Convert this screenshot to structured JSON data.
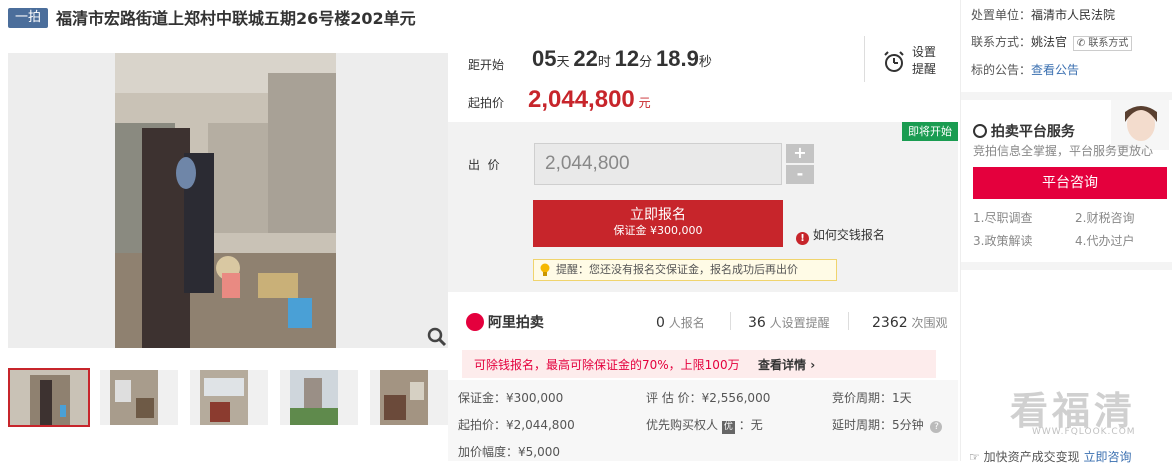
{
  "header": {
    "tag": "一拍",
    "title": "福清市宏路街道上郑村中联城五期26号楼202单元"
  },
  "countdown": {
    "label": "距开始",
    "days": "05",
    "days_unit": "天",
    "hours": "22",
    "hours_unit": "时",
    "minutes": "12",
    "minutes_unit": "分",
    "seconds": "18.9",
    "seconds_unit": "秒"
  },
  "reminder": {
    "line1": "设置",
    "line2": "提醒"
  },
  "start_price": {
    "label": "起拍价",
    "value": "2,044,800",
    "unit": "元"
  },
  "bid": {
    "badge": "即将开始",
    "label": "出  价",
    "input_value": "2,044,800",
    "plus": "+",
    "minus": "-",
    "signup_label": "立即报名",
    "deposit_label": "保证金 ¥300,000",
    "how_to_label": "如何交钱报名",
    "tip": "提醒：您还没有报名交保证金，报名成功后再出价"
  },
  "stats": {
    "brand": "阿里拍卖",
    "signups": "0",
    "signups_label": "人报名",
    "reminders": "36",
    "reminders_label": "人设置提醒",
    "views": "2362",
    "views_label": "次围观"
  },
  "warning": {
    "text": "可除钱报名，最高可除保证金的70%，上限100万",
    "link": "查看详情"
  },
  "details": {
    "deposit": "保证金：¥300,000",
    "appraisal": "评 估 价：¥2,556,000",
    "period": "竞价周期：1天",
    "start_price": "起拍价：¥2,044,800",
    "priority": "优先购买权人",
    "priority_value": "无",
    "extend": "延时周期：5分钟",
    "increment": "加价幅度：¥5,000"
  },
  "side": {
    "court_label": "处置单位：",
    "court": "福清市人民法院",
    "contact_label": "联系方式：",
    "contact": "姚法官",
    "contact_button": "联系方式",
    "notice_label": "标的公告：",
    "notice_link": "查看公告",
    "service_title": "拍卖平台服务",
    "service_sub": "竞拍信息全掌握，平台服务更放心",
    "consult_button": "平台咨询",
    "services": [
      "1.尽职调查",
      "2.财税咨询",
      "3.政策解读",
      "4.代办过户"
    ],
    "bottom_text": "加快资产成交变现",
    "bottom_link": "立即咨询",
    "watermark": "看福清",
    "watermark_url": "WWW.FQLOOK.COM"
  },
  "colors": {
    "accent_red": "#c7252b",
    "tag_blue": "#4b6e9b",
    "badge_green": "#1a9c51",
    "consult_red": "#e4003d"
  }
}
